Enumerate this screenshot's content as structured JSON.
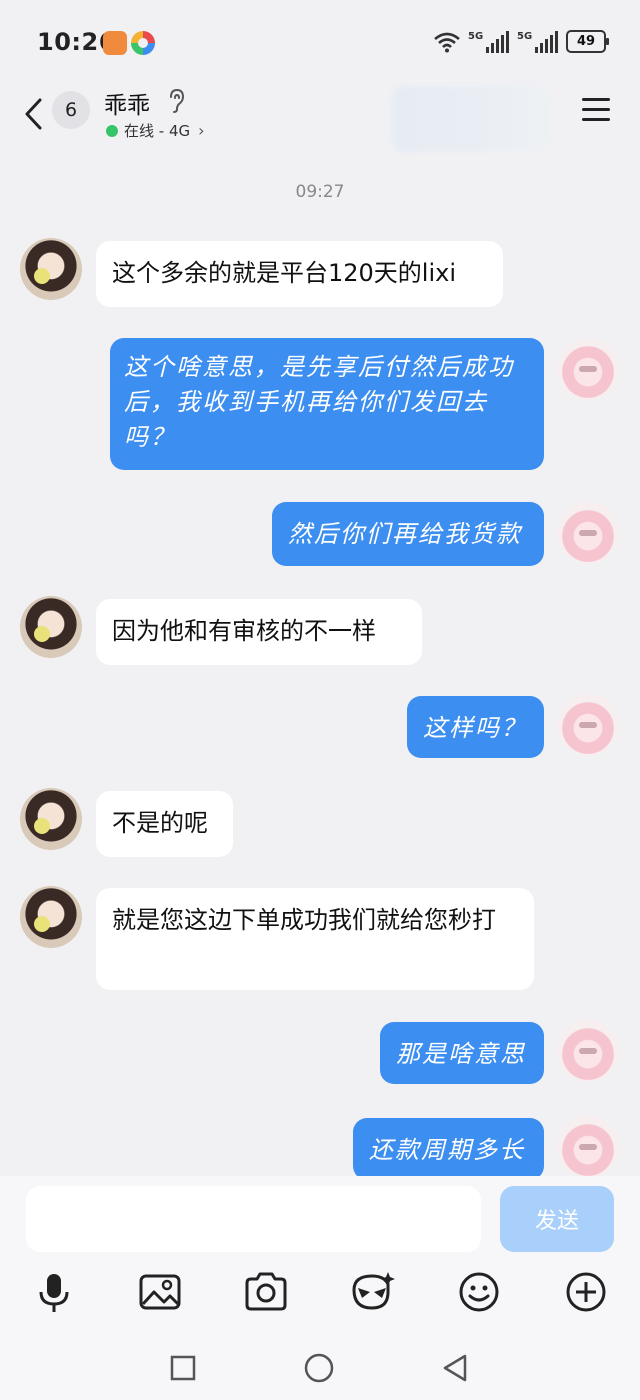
{
  "status_bar": {
    "time": "10:26",
    "network_1": "5G",
    "network_2": "5G",
    "battery": "49"
  },
  "header": {
    "unread_count": "6",
    "contact_name": "乖乖",
    "online_status": "在线 - 4G",
    "chevron": "›"
  },
  "chat": {
    "time_separator": "09:27",
    "messages": [
      {
        "side": "in",
        "text": "这个多余的就是平台120天的lixi"
      },
      {
        "side": "out",
        "text": "这个啥意思，是先享后付然后成功后，我收到手机再给你们发回去吗？"
      },
      {
        "side": "out",
        "text": "然后你们再给我货款"
      },
      {
        "side": "in",
        "text": "因为他和有审核的不一样"
      },
      {
        "side": "out",
        "text": "这样吗？"
      },
      {
        "side": "in",
        "text": "不是的呢"
      },
      {
        "side": "in",
        "text": "就是您这边下单成功我们就给您秒打"
      },
      {
        "side": "out",
        "text": "那是啥意思"
      },
      {
        "side": "out",
        "text": "还款周期多长"
      }
    ]
  },
  "composer": {
    "input_value": "",
    "send_label": "发送"
  },
  "icons": {
    "toolbar": [
      "microphone-icon",
      "image-icon",
      "camera-icon",
      "sticker-icon",
      "emoji-icon",
      "plus-icon"
    ],
    "nav": [
      "recents-icon",
      "home-icon",
      "back-triangle-icon"
    ]
  },
  "colors": {
    "outgoing_bubble": "#3c8ef0",
    "incoming_bubble": "#ffffff",
    "online_dot": "#35c567",
    "send_button": "#a9d0fb"
  }
}
